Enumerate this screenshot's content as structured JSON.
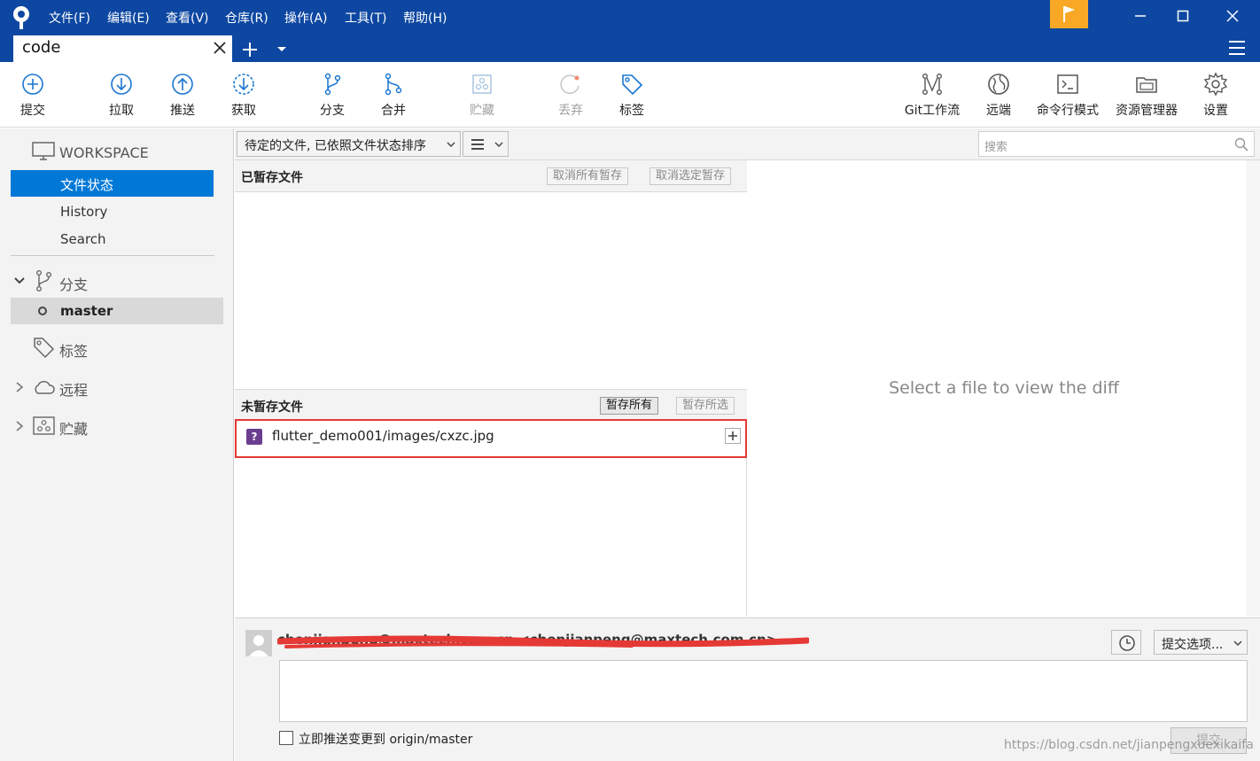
{
  "menu": [
    "文件(F)",
    "编辑(E)",
    "查看(V)",
    "仓库(R)",
    "操作(A)",
    "工具(T)",
    "帮助(H)"
  ],
  "tab": {
    "title": "code"
  },
  "toolbar": {
    "commit": "提交",
    "pull": "拉取",
    "push": "推送",
    "fetch": "获取",
    "branch": "分支",
    "merge": "合并",
    "stash": "贮藏",
    "discard": "丢弃",
    "tag": "标签",
    "gitflow": "Git工作流",
    "remote": "远端",
    "terminal": "命令行模式",
    "explorer": "资源管理器",
    "settings": "设置"
  },
  "sidebar": {
    "workspace": "WORKSPACE",
    "items": [
      "文件状态",
      "History",
      "Search"
    ],
    "branches": "分支",
    "branch_current": "master",
    "tags": "标签",
    "remotes": "远程",
    "stashes": "贮藏"
  },
  "filter": {
    "sort_label": "待定的文件, 已依照文件状态排序",
    "search_placeholder": "搜索"
  },
  "staged": {
    "title": "已暂存文件",
    "unstage_all": "取消所有暂存",
    "unstage_selected": "取消选定暂存"
  },
  "unstaged": {
    "title": "未暂存文件",
    "stage_all": "暂存所有",
    "stage_selected": "暂存所选",
    "files": [
      "flutter_demo001/images/cxzc.jpg"
    ]
  },
  "diff": {
    "placeholder": "Select a file to view the diff"
  },
  "commit": {
    "author": "chenjianpeng@maxtech.com.cn <chenjianpeng@maxtech.com.cn>",
    "options": "提交选项...",
    "push_label": "立即推送变更到 origin/master",
    "submit": "提交"
  },
  "watermark": "https://blog.csdn.net/jianpengxuexikaifa",
  "colors": {
    "titlebar": "#0d47a1",
    "accent": "#0078d7",
    "flag": "#f9a825",
    "highlight": "#e53935"
  }
}
